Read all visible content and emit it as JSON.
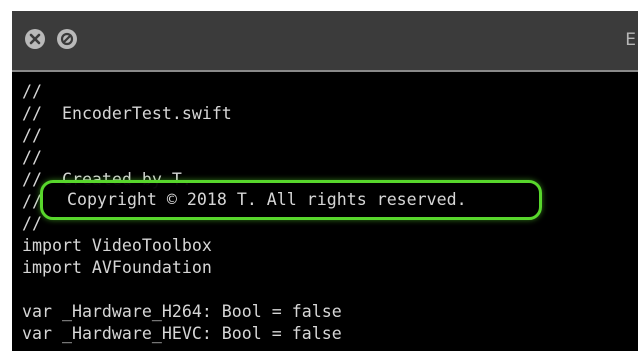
{
  "window": {
    "title_fragment": "E",
    "close_icon": "close-x-icon",
    "minimize_icon": "minimize-slash-icon"
  },
  "editor": {
    "lines": [
      "//",
      "//  EncoderTest.swift",
      "//",
      "//",
      "//  Created by T.",
      "//",
      "//",
      "import VideoToolbox",
      "import AVFoundation",
      "",
      "var _Hardware_H264: Bool = false",
      "var _Hardware_HEVC: Bool = false"
    ],
    "highlighted_line": "Copyright © 2018 T. All rights reserved."
  },
  "colors": {
    "highlight_border": "#58d62c",
    "code_text": "#d6d6d6",
    "titlebar": "#3b3b3b"
  }
}
